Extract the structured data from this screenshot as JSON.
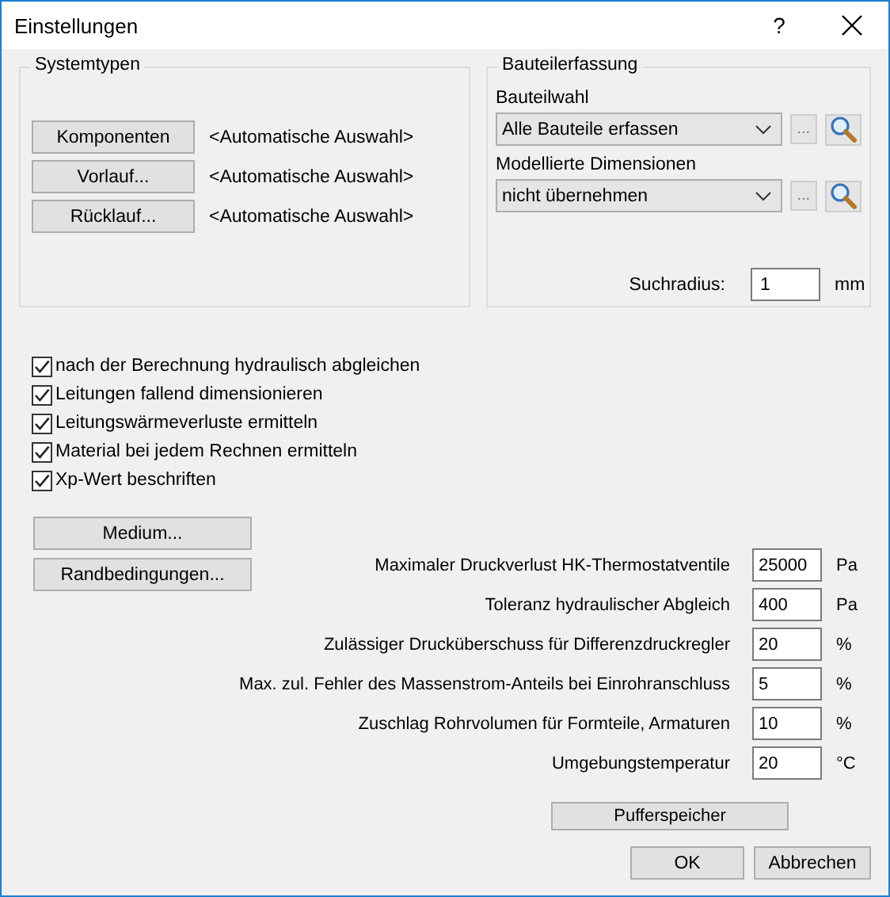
{
  "window": {
    "title": "Einstellungen",
    "help": "?"
  },
  "systemtypen": {
    "title": "Systemtypen",
    "rows": [
      {
        "button": "Komponenten",
        "value": "<Automatische Auswahl>"
      },
      {
        "button": "Vorlauf...",
        "value": "<Automatische Auswahl>"
      },
      {
        "button": "Rücklauf...",
        "value": "<Automatische Auswahl>"
      }
    ]
  },
  "bauteilerfassung": {
    "title": "Bauteilerfassung",
    "fields": [
      {
        "label": "Bauteilwahl",
        "value": "Alle Bauteile erfassen",
        "more": "..."
      },
      {
        "label": "Modellierte Dimensionen",
        "value": "nicht übernehmen",
        "more": "..."
      }
    ],
    "search_radius": {
      "label": "Suchradius:",
      "value": "1",
      "unit": "mm"
    }
  },
  "options": [
    {
      "label": "nach der Berechnung hydraulisch abgleichen",
      "checked": true
    },
    {
      "label": "Leitungen fallend dimensionieren",
      "checked": true
    },
    {
      "label": "Leitungswärmeverluste ermitteln",
      "checked": true
    },
    {
      "label": "Material bei jedem Rechnen ermitteln",
      "checked": true
    },
    {
      "label": "Xp-Wert beschriften",
      "checked": true
    }
  ],
  "side_buttons": [
    "Medium...",
    "Randbedingungen..."
  ],
  "parameters": [
    {
      "label": "Maximaler Druckverlust HK-Thermostatventile",
      "value": "25000",
      "unit": "Pa"
    },
    {
      "label": "Toleranz hydraulischer Abgleich",
      "value": "400",
      "unit": "Pa"
    },
    {
      "label": "Zulässiger Drucküberschuss für Differenzdruckregler",
      "value": "20",
      "unit": "%"
    },
    {
      "label": "Max. zul. Fehler des Massenstrom-Anteils bei Einrohranschluss",
      "value": "5",
      "unit": "%"
    },
    {
      "label": "Zuschlag Rohrvolumen für Formteile, Armaturen",
      "value": "10",
      "unit": "%"
    },
    {
      "label": "Umgebungstemperatur",
      "value": "20",
      "unit": "°C"
    }
  ],
  "buffer_button": "Pufferspeicher",
  "buttons": [
    "OK",
    "Abbrechen"
  ]
}
